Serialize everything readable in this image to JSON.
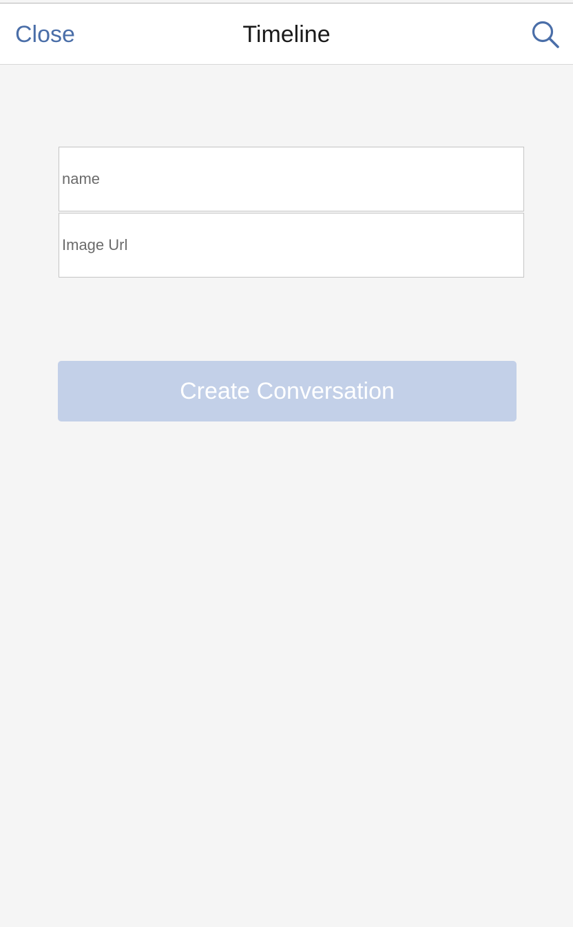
{
  "navbar": {
    "close_label": "Close",
    "title": "Timeline",
    "search_icon": "search-icon"
  },
  "form": {
    "name_placeholder": "name",
    "name_value": "",
    "image_url_placeholder": "Image Url",
    "image_url_value": "",
    "create_button_label": "Create Conversation"
  },
  "colors": {
    "accent": "#4a6ea8",
    "button_disabled": "#c3d0e8",
    "background": "#f5f5f5"
  }
}
